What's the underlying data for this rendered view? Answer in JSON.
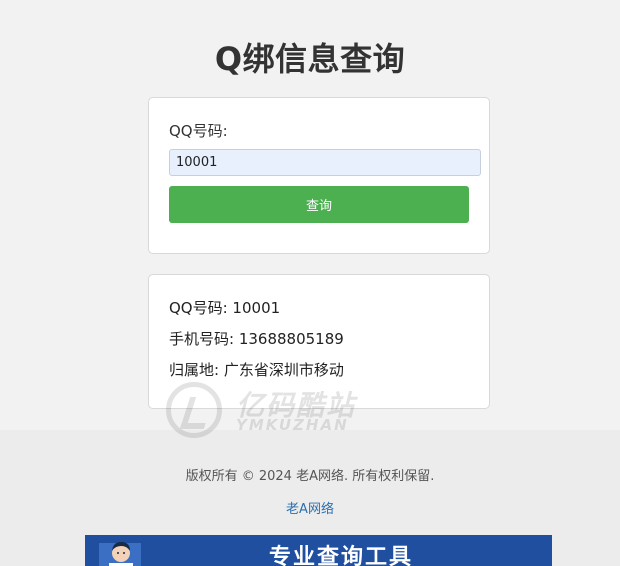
{
  "page": {
    "title": "Q绑信息查询"
  },
  "query_form": {
    "label": "QQ号码:",
    "input_value": "10001",
    "button_label": "查询"
  },
  "result": {
    "qq_line": "QQ号码: 10001",
    "phone_line": "手机号码: 13688805189",
    "location_line": "归属地: 广东省深圳市移动"
  },
  "watermark": {
    "name_cn": "亿码酷站",
    "name_en": "YMKUZHAN"
  },
  "footer": {
    "copyright": "版权所有 © 2024 老A网络. 所有权利保留.",
    "link_text": "老A网络"
  },
  "banner": {
    "text": "专业查询工具"
  },
  "colors": {
    "button": "#4caf50",
    "input_bg": "#e8f0fe",
    "link": "#2a6fb0",
    "banner_bg": "#1f4f9e"
  },
  "icons": {
    "watermark_logo": "ymkuzhan-logo-icon",
    "banner_figure": "person-illustration-icon"
  }
}
